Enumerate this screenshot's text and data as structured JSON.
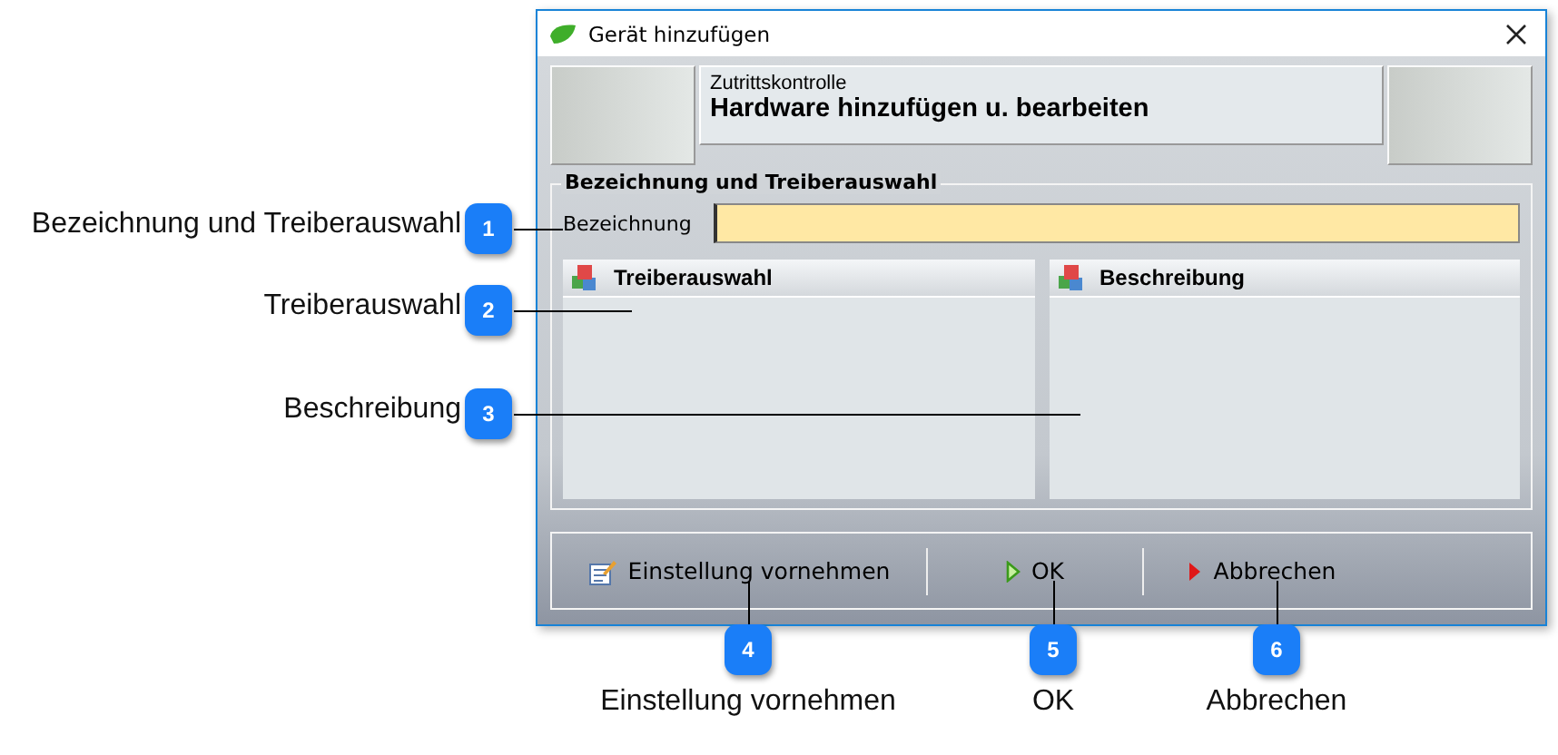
{
  "window": {
    "title": "Gerät hinzufügen"
  },
  "header": {
    "subtitle": "Zutrittskontrolle",
    "title": "Hardware hinzufügen u. bearbeiten"
  },
  "group": {
    "title": "Bezeichnung und Treiberauswahl",
    "field_label": "Bezeichnung"
  },
  "panels": [
    {
      "title": "Treiberauswahl"
    },
    {
      "title": "Beschreibung"
    }
  ],
  "buttons": [
    {
      "label": "Einstellung vornehmen",
      "kind": "settings"
    },
    {
      "label": "OK",
      "kind": "ok"
    },
    {
      "label": "Abbrechen",
      "kind": "cancel"
    }
  ],
  "callouts": [
    {
      "number": "1",
      "label": "Bezeichnung und Treiberauswahl"
    },
    {
      "number": "2",
      "label": "Treiberauswahl"
    },
    {
      "number": "3",
      "label": "Beschreibung"
    },
    {
      "number": "4",
      "label": "Einstellung vornehmen"
    },
    {
      "number": "5",
      "label": "OK"
    },
    {
      "number": "6",
      "label": "Abbrechen"
    }
  ]
}
